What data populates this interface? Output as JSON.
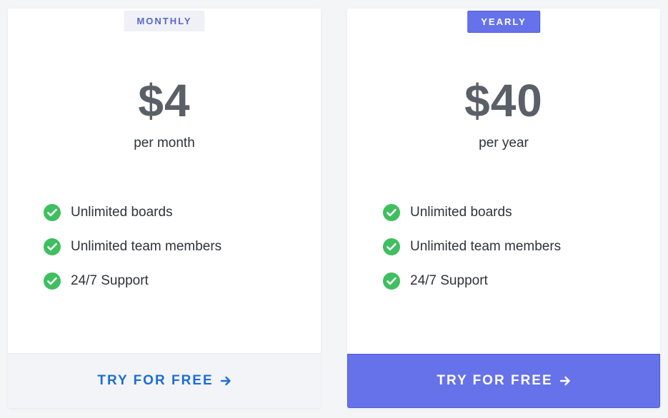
{
  "colors": {
    "background": "#f4f5f7",
    "card": "#ffffff",
    "accent": "#6672ea",
    "accent_border": "#4e5ad7",
    "text_dark": "#2f3338",
    "price_gray": "#5a6067",
    "check_green": "#3fbf5f",
    "link_blue": "#1b6dd7"
  },
  "plans": [
    {
      "badge": "MONTHLY",
      "price": "$4",
      "period": "per month",
      "features": [
        {
          "icon": "check-circle-icon",
          "text": "Unlimited boards"
        },
        {
          "icon": "check-circle-icon",
          "text": "Unlimited team members"
        },
        {
          "icon": "check-circle-icon",
          "text": "24/7 Support"
        }
      ],
      "cta": "TRY FOR FREE",
      "cta_icon": "arrow-right-icon"
    },
    {
      "badge": "YEARLY",
      "price": "$40",
      "period": "per year",
      "features": [
        {
          "icon": "check-circle-icon",
          "text": "Unlimited boards"
        },
        {
          "icon": "check-circle-icon",
          "text": "Unlimited team members"
        },
        {
          "icon": "check-circle-icon",
          "text": "24/7 Support"
        }
      ],
      "cta": "TRY FOR FREE",
      "cta_icon": "arrow-right-icon"
    }
  ]
}
